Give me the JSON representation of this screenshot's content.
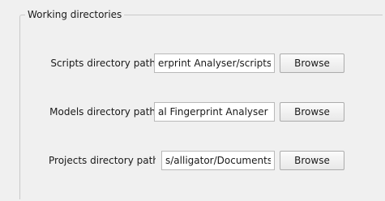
{
  "group": {
    "title": "Working directories"
  },
  "rows": [
    {
      "label": "Scripts directory path",
      "value": "erprint Analyser/scripts",
      "button": "Browse"
    },
    {
      "label": "Models directory path",
      "value": "al Fingerprint Analyser",
      "button": "Browse"
    },
    {
      "label": "Projects directory path",
      "value": "s/alligator/Documents",
      "button": "Browse"
    }
  ]
}
